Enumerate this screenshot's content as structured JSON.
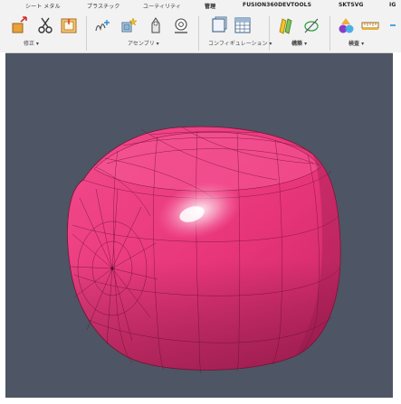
{
  "tabs": [
    {
      "label": "シート メタル"
    },
    {
      "label": "プラスチック"
    },
    {
      "label": "ユーティリティ"
    },
    {
      "label": "管理"
    },
    {
      "label": "FUSION360DEVTOOLS"
    },
    {
      "label": "SKTSVG"
    },
    {
      "label": "IG"
    }
  ],
  "groups": [
    {
      "label": "修正 ▾"
    },
    {
      "label": "アセンブリ ▾"
    },
    {
      "label": "コンフィギュレーション ▾"
    },
    {
      "label": "構築 ▾"
    },
    {
      "label": "検査 ▾"
    }
  ],
  "icons": [
    {
      "name": "press-pull-icon"
    },
    {
      "name": "fillet-icon"
    },
    {
      "name": "shell-icon"
    },
    {
      "name": "new-component-icon"
    },
    {
      "name": "joint-icon"
    },
    {
      "name": "as-built-joint-icon"
    },
    {
      "name": "contact-sets-icon"
    },
    {
      "name": "configure-icon"
    },
    {
      "name": "configuration-table-icon"
    },
    {
      "name": "offset-plane-icon"
    },
    {
      "name": "axis-icon"
    },
    {
      "name": "inspect-icon"
    },
    {
      "name": "measure-icon"
    }
  ],
  "colors": {
    "viewport_bg": "#4e5564",
    "model_fill": "#e8357a",
    "model_edge": "#7a1438",
    "toolbar_bg": "#f2f2f2"
  }
}
